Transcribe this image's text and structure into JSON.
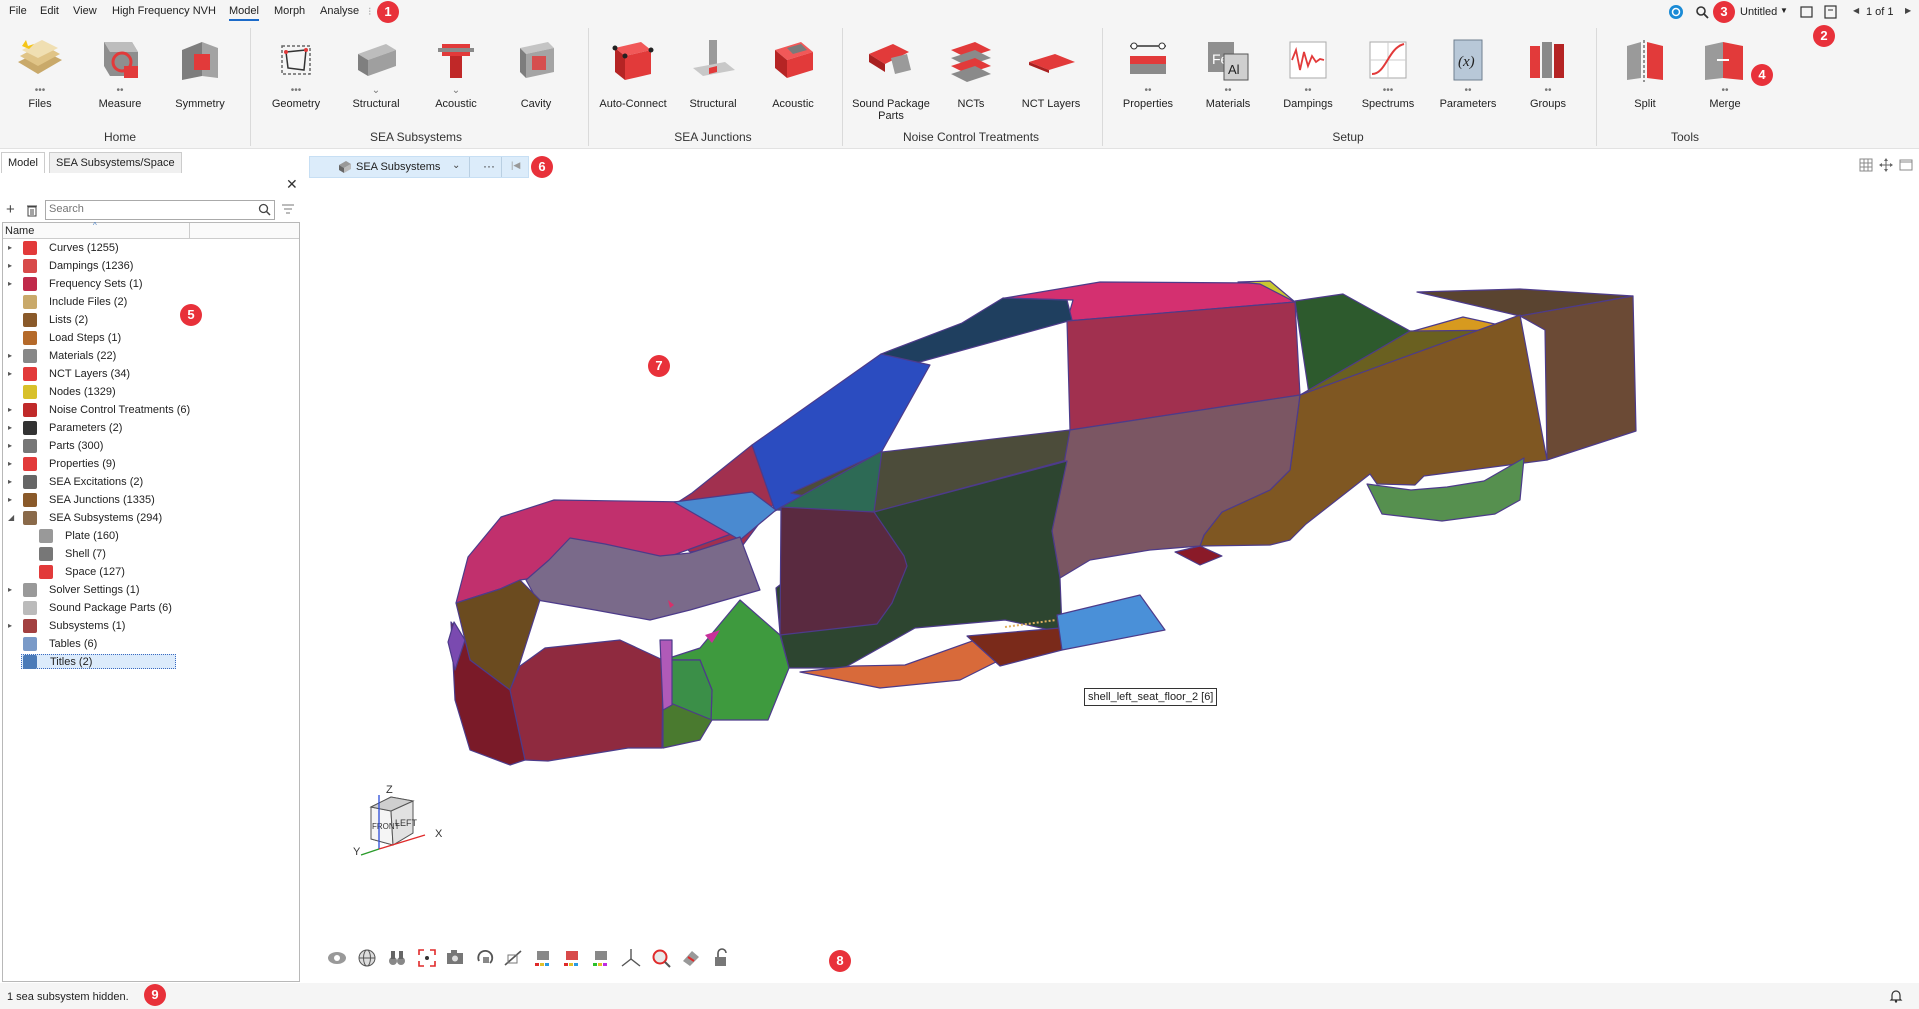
{
  "menu": {
    "items": [
      "File",
      "Edit",
      "View",
      "High Frequency NVH",
      "Model",
      "Morph",
      "Analyse"
    ],
    "active": "Model",
    "doc_title": "Untitled",
    "page": "1 of 1"
  },
  "ribbon": {
    "groups": [
      {
        "label": "Home",
        "tools": [
          "Files",
          "Measure",
          "Symmetry"
        ]
      },
      {
        "label": "SEA Subsystems",
        "tools": [
          "Geometry",
          "Structural",
          "Acoustic",
          "Cavity"
        ]
      },
      {
        "label": "SEA Junctions",
        "tools": [
          "Auto-Connect",
          "Structural",
          "Acoustic"
        ]
      },
      {
        "label": "Noise Control Treatments",
        "tools": [
          "Sound Package Parts",
          "NCTs",
          "NCT Layers"
        ]
      },
      {
        "label": "Setup",
        "tools": [
          "Properties",
          "Materials",
          "Dampings",
          "Spectrums",
          "Parameters",
          "Groups"
        ]
      },
      {
        "label": "Tools",
        "tools": [
          "Split",
          "Merge"
        ]
      }
    ]
  },
  "panel": {
    "tabs": [
      "Model",
      "SEA Subsystems/Space"
    ],
    "search_placeholder": "Search",
    "column_header": "Name",
    "tree": [
      {
        "label": "Curves  (1255)",
        "expandable": true
      },
      {
        "label": "Dampings  (1236)",
        "expandable": true
      },
      {
        "label": "Frequency Sets  (1)",
        "expandable": true
      },
      {
        "label": "Include Files  (2)",
        "expandable": false
      },
      {
        "label": "Lists  (2)",
        "expandable": false
      },
      {
        "label": "Load Steps  (1)",
        "expandable": false
      },
      {
        "label": "Materials  (22)",
        "expandable": true
      },
      {
        "label": "NCT Layers  (34)",
        "expandable": true
      },
      {
        "label": "Nodes  (1329)",
        "expandable": false
      },
      {
        "label": "Noise Control Treatments  (6)",
        "expandable": true
      },
      {
        "label": "Parameters  (2)",
        "expandable": true
      },
      {
        "label": "Parts  (300)",
        "expandable": true
      },
      {
        "label": "Properties  (9)",
        "expandable": true
      },
      {
        "label": "SEA Excitations  (2)",
        "expandable": true
      },
      {
        "label": "SEA Junctions  (1335)",
        "expandable": true
      },
      {
        "label": "SEA Subsystems  (294)",
        "expandable": true,
        "expanded": true
      },
      {
        "label": "Plate  (160)",
        "child": true
      },
      {
        "label": "Shell  (7)",
        "child": true
      },
      {
        "label": "Space  (127)",
        "child": true
      },
      {
        "label": "Solver Settings  (1)",
        "expandable": true
      },
      {
        "label": "Sound Package Parts  (6)",
        "expandable": false
      },
      {
        "label": "Subsystems  (1)",
        "expandable": true
      },
      {
        "label": "Tables  (6)",
        "expandable": false
      },
      {
        "label": "Titles  (2)",
        "expandable": false,
        "selected": true
      }
    ]
  },
  "viewport": {
    "filter_label": "SEA Subsystems",
    "tooltip": "shell_left_seat_floor_2  [6]",
    "cube_left": "LEFT",
    "cube_front": "FRONT",
    "axis_x": "X",
    "axis_y": "Y",
    "axis_z": "Z"
  },
  "status": {
    "text": "1 sea subsystem hidden."
  },
  "badges": [
    "1",
    "2",
    "3",
    "4",
    "5",
    "6",
    "7",
    "8",
    "9"
  ]
}
